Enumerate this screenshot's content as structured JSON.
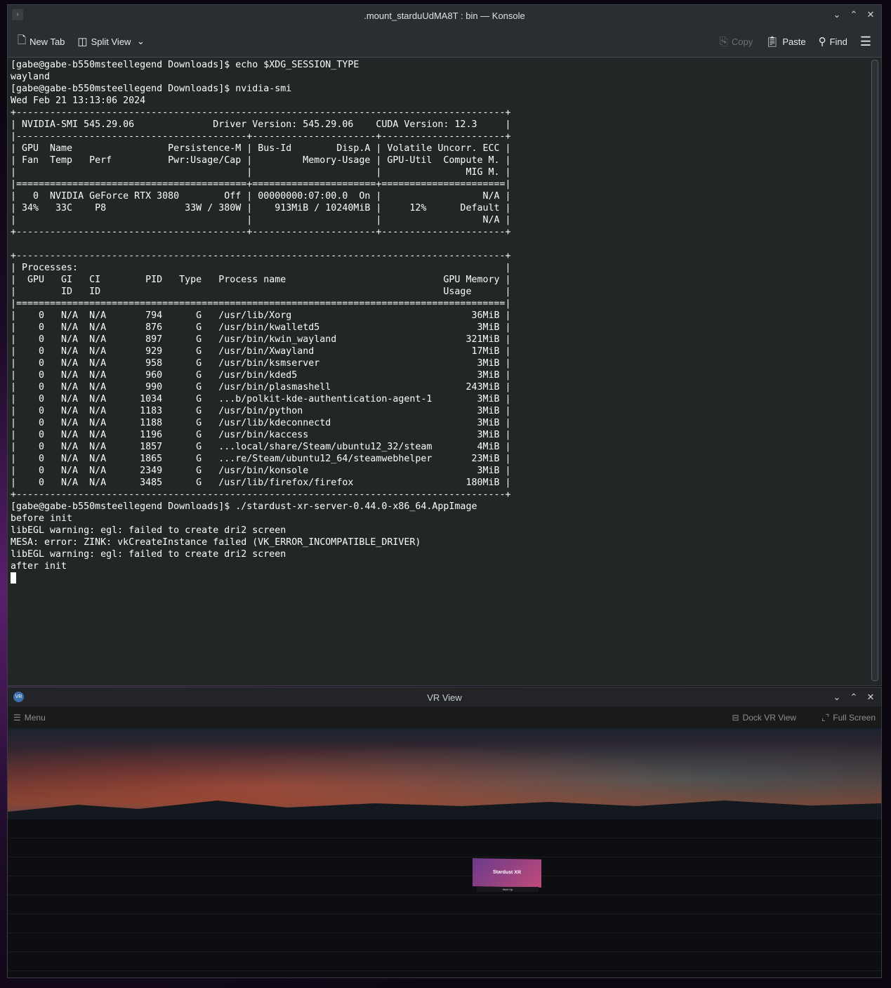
{
  "konsole": {
    "title": ".mount_starduUdMA8T : bin — Konsole",
    "toolbar": {
      "new_tab": "New Tab",
      "split_view": "Split View",
      "copy": "Copy",
      "paste": "Paste",
      "find": "Find"
    },
    "lines_before": [
      "[gabe@gabe-b550msteellegend Downloads]$ echo $XDG_SESSION_TYPE",
      "wayland",
      "[gabe@gabe-b550msteellegend Downloads]$ nvidia-smi",
      "Wed Feb 21 13:13:06 2024",
      "+---------------------------------------------------------------------------------------+",
      "| NVIDIA-SMI 545.29.06              Driver Version: 545.29.06    CUDA Version: 12.3     |",
      "|-----------------------------------------+----------------------+----------------------+",
      "| GPU  Name                 Persistence-M | Bus-Id        Disp.A | Volatile Uncorr. ECC |",
      "| Fan  Temp   Perf          Pwr:Usage/Cap |         Memory-Usage | GPU-Util  Compute M. |",
      "|                                         |                      |               MIG M. |",
      "|=========================================+======================+======================|",
      "|   0  NVIDIA GeForce RTX 3080        Off | 00000000:07:00.0  On |                  N/A |",
      "| 34%   33C    P8              33W / 380W |    913MiB / 10240MiB |     12%      Default |",
      "|                                         |                      |                  N/A |",
      "+-----------------------------------------+----------------------+----------------------+",
      "",
      "+---------------------------------------------------------------------------------------+",
      "| Processes:                                                                            |",
      "|  GPU   GI   CI        PID   Type   Process name                            GPU Memory |",
      "|        ID   ID                                                             Usage      |",
      "|=======================================================================================|"
    ],
    "processes": [
      {
        "gpu": "0",
        "gi": "N/A",
        "ci": "N/A",
        "pid": "794",
        "type": "G",
        "name": "/usr/lib/Xorg",
        "mem": "36MiB"
      },
      {
        "gpu": "0",
        "gi": "N/A",
        "ci": "N/A",
        "pid": "876",
        "type": "G",
        "name": "/usr/bin/kwalletd5",
        "mem": "3MiB"
      },
      {
        "gpu": "0",
        "gi": "N/A",
        "ci": "N/A",
        "pid": "897",
        "type": "G",
        "name": "/usr/bin/kwin_wayland",
        "mem": "321MiB"
      },
      {
        "gpu": "0",
        "gi": "N/A",
        "ci": "N/A",
        "pid": "929",
        "type": "G",
        "name": "/usr/bin/Xwayland",
        "mem": "17MiB"
      },
      {
        "gpu": "0",
        "gi": "N/A",
        "ci": "N/A",
        "pid": "958",
        "type": "G",
        "name": "/usr/bin/ksmserver",
        "mem": "3MiB"
      },
      {
        "gpu": "0",
        "gi": "N/A",
        "ci": "N/A",
        "pid": "960",
        "type": "G",
        "name": "/usr/bin/kded5",
        "mem": "3MiB"
      },
      {
        "gpu": "0",
        "gi": "N/A",
        "ci": "N/A",
        "pid": "990",
        "type": "G",
        "name": "/usr/bin/plasmashell",
        "mem": "243MiB"
      },
      {
        "gpu": "0",
        "gi": "N/A",
        "ci": "N/A",
        "pid": "1034",
        "type": "G",
        "name": "...b/polkit-kde-authentication-agent-1",
        "mem": "3MiB"
      },
      {
        "gpu": "0",
        "gi": "N/A",
        "ci": "N/A",
        "pid": "1183",
        "type": "G",
        "name": "/usr/bin/python",
        "mem": "3MiB"
      },
      {
        "gpu": "0",
        "gi": "N/A",
        "ci": "N/A",
        "pid": "1188",
        "type": "G",
        "name": "/usr/lib/kdeconnectd",
        "mem": "3MiB"
      },
      {
        "gpu": "0",
        "gi": "N/A",
        "ci": "N/A",
        "pid": "1196",
        "type": "G",
        "name": "/usr/bin/kaccess",
        "mem": "3MiB"
      },
      {
        "gpu": "0",
        "gi": "N/A",
        "ci": "N/A",
        "pid": "1857",
        "type": "G",
        "name": "...local/share/Steam/ubuntu12_32/steam",
        "mem": "4MiB"
      },
      {
        "gpu": "0",
        "gi": "N/A",
        "ci": "N/A",
        "pid": "1865",
        "type": "G",
        "name": "...re/Steam/ubuntu12_64/steamwebhelper",
        "mem": "23MiB"
      },
      {
        "gpu": "0",
        "gi": "N/A",
        "ci": "N/A",
        "pid": "2349",
        "type": "G",
        "name": "/usr/bin/konsole",
        "mem": "3MiB"
      },
      {
        "gpu": "0",
        "gi": "N/A",
        "ci": "N/A",
        "pid": "3485",
        "type": "G",
        "name": "/usr/lib/firefox/firefox",
        "mem": "180MiB"
      }
    ],
    "lines_after": [
      "+---------------------------------------------------------------------------------------+",
      "[gabe@gabe-b550msteellegend Downloads]$ ./stardust-xr-server-0.44.0-x86_64.AppImage",
      "before init",
      "libEGL warning: egl: failed to create dri2 screen",
      "MESA: error: ZINK: vkCreateInstance failed (VK_ERROR_INCOMPATIBLE_DRIVER)",
      "libEGL warning: egl: failed to create dri2 screen",
      "after init"
    ]
  },
  "vr_view": {
    "title": "VR View",
    "menu": "Menu",
    "dock": "Dock VR View",
    "fullscreen": "Full Screen",
    "panel_title": "Stardust XR",
    "panel_sub": "Next Up",
    "logo": "VR"
  }
}
